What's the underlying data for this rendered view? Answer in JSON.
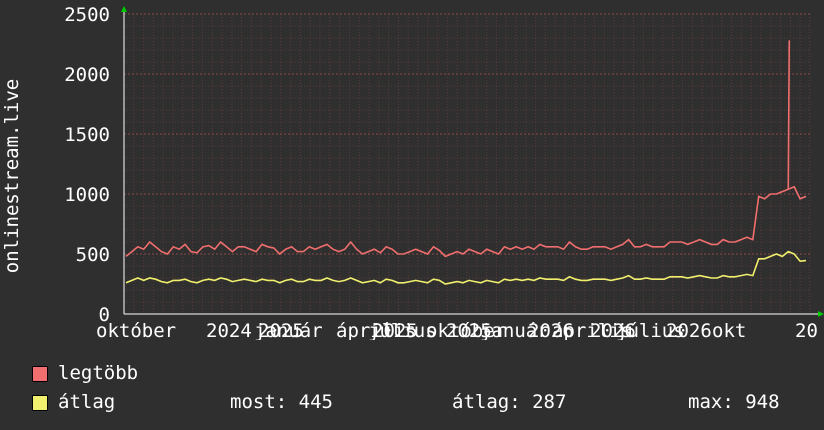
{
  "chart_data": {
    "type": "line",
    "ylabel": "onlinestream.live",
    "ylim": [
      0,
      2500
    ],
    "yticks": [
      "0",
      "500",
      "1000",
      "1500",
      "2000",
      "2500"
    ],
    "xtick_labels": [
      "október",
      "2024",
      "január",
      "2025",
      "április",
      "július",
      "2025",
      "október",
      "2025",
      "január",
      "2026",
      "április",
      "2026",
      "július",
      "2026",
      "okt"
    ],
    "x_tail_label": "20",
    "grid": true,
    "series": [
      {
        "name": "legtöbb",
        "color": "#f06e6e",
        "values": [
          480,
          520,
          560,
          540,
          600,
          560,
          520,
          500,
          560,
          540,
          580,
          520,
          510,
          560,
          570,
          540,
          600,
          560,
          520,
          560,
          560,
          540,
          520,
          580,
          560,
          550,
          500,
          540,
          560,
          520,
          520,
          560,
          540,
          560,
          580,
          540,
          520,
          540,
          600,
          540,
          500,
          520,
          540,
          510,
          560,
          540,
          500,
          500,
          520,
          540,
          520,
          500,
          560,
          530,
          480,
          500,
          520,
          500,
          540,
          520,
          500,
          540,
          520,
          500,
          560,
          540,
          560,
          540,
          560,
          540,
          580,
          560,
          560,
          560,
          540,
          600,
          560,
          540,
          540,
          560,
          560,
          560,
          540,
          560,
          580,
          620,
          560,
          560,
          580,
          560,
          560,
          560,
          600,
          600,
          600,
          580,
          600,
          620,
          600,
          580,
          580,
          620,
          600,
          600,
          620,
          640,
          620,
          980,
          960,
          1000,
          1000,
          1020,
          1040,
          1060,
          960,
          980
        ]
      },
      {
        "name": "átlag",
        "color": "#f0f06e",
        "values": [
          260,
          280,
          300,
          280,
          300,
          290,
          270,
          260,
          280,
          280,
          290,
          270,
          260,
          280,
          290,
          280,
          300,
          290,
          270,
          280,
          290,
          280,
          270,
          290,
          280,
          280,
          260,
          280,
          290,
          270,
          270,
          290,
          280,
          280,
          300,
          280,
          270,
          280,
          300,
          280,
          260,
          270,
          280,
          260,
          290,
          280,
          260,
          260,
          270,
          280,
          270,
          260,
          290,
          280,
          250,
          260,
          270,
          260,
          280,
          270,
          260,
          280,
          270,
          260,
          290,
          280,
          290,
          280,
          290,
          280,
          300,
          290,
          290,
          290,
          280,
          310,
          290,
          280,
          280,
          290,
          290,
          290,
          280,
          290,
          300,
          320,
          290,
          290,
          300,
          290,
          290,
          290,
          310,
          310,
          310,
          300,
          310,
          320,
          310,
          300,
          300,
          320,
          310,
          310,
          320,
          330,
          320,
          460,
          460,
          480,
          500,
          480,
          520,
          500,
          440,
          445
        ]
      }
    ]
  },
  "legend": [
    {
      "label": "legtöbb",
      "color": "#f06e6e"
    },
    {
      "label": "átlag",
      "color": "#f0f06e"
    }
  ],
  "stats": {
    "most": "most: 445",
    "atlag": "átlag: 287",
    "max": "max: 948"
  },
  "colors": {
    "background": "#2f2f2f",
    "grid": "#6e3c3c",
    "axis": "#ffffff"
  }
}
